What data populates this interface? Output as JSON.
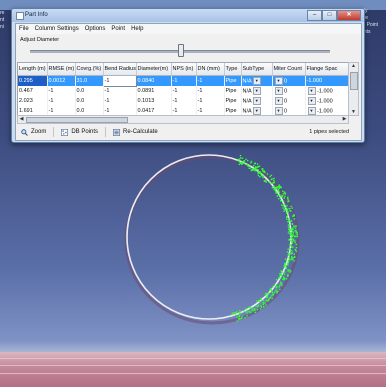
{
  "window": {
    "title": "Part Info",
    "buttons": {
      "minimize": "–",
      "maximize": "□",
      "close": "✕"
    }
  },
  "menu": [
    "File",
    "Column Settings",
    "Options",
    "Point",
    "Help"
  ],
  "slider": {
    "label": "Adjust Diameter"
  },
  "table": {
    "columns": [
      "Length (m)",
      "RMSE (m)",
      "Covrg.(%)",
      "Bend Radius",
      "Diameter(m)",
      "NPS (in)",
      "DN (mm)",
      "Type",
      "SubType",
      "Miter Count",
      "Flange Spac"
    ],
    "rows": [
      [
        "0.295",
        "0.0012",
        "31.0",
        "-1",
        "0.0840",
        "-1",
        "-1",
        "Pipe",
        "N/A",
        "0",
        "-1.000"
      ],
      [
        "0.467",
        "-1",
        "0.0",
        "-1",
        "0.0891",
        "-1",
        "-1",
        "Pipe",
        "N/A",
        "0",
        "-1.000"
      ],
      [
        "2.023",
        "-1",
        "0.0",
        "-1",
        "0.1013",
        "-1",
        "-1",
        "Pipe",
        "N/A",
        "0",
        "-1.000"
      ],
      [
        "1.691",
        "-1",
        "0.0",
        "-1",
        "0.0417",
        "-1",
        "-1",
        "Pipe",
        "N/A",
        "0",
        "-1.000"
      ]
    ]
  },
  "toolbar": {
    "zoom": "Zoom",
    "db_points": "DB Points",
    "recalc": "Re-Calculate"
  },
  "status": "1 pipes selected",
  "background_text": {
    "right": [
      "ally",
      "ave",
      "ch Point",
      "oints"
    ],
    "left": [
      "re",
      "nt",
      "ni"
    ]
  },
  "colors": {
    "selection": "#3399ff",
    "point_cloud": "#33ff33",
    "circle": "#e8e8f0"
  }
}
